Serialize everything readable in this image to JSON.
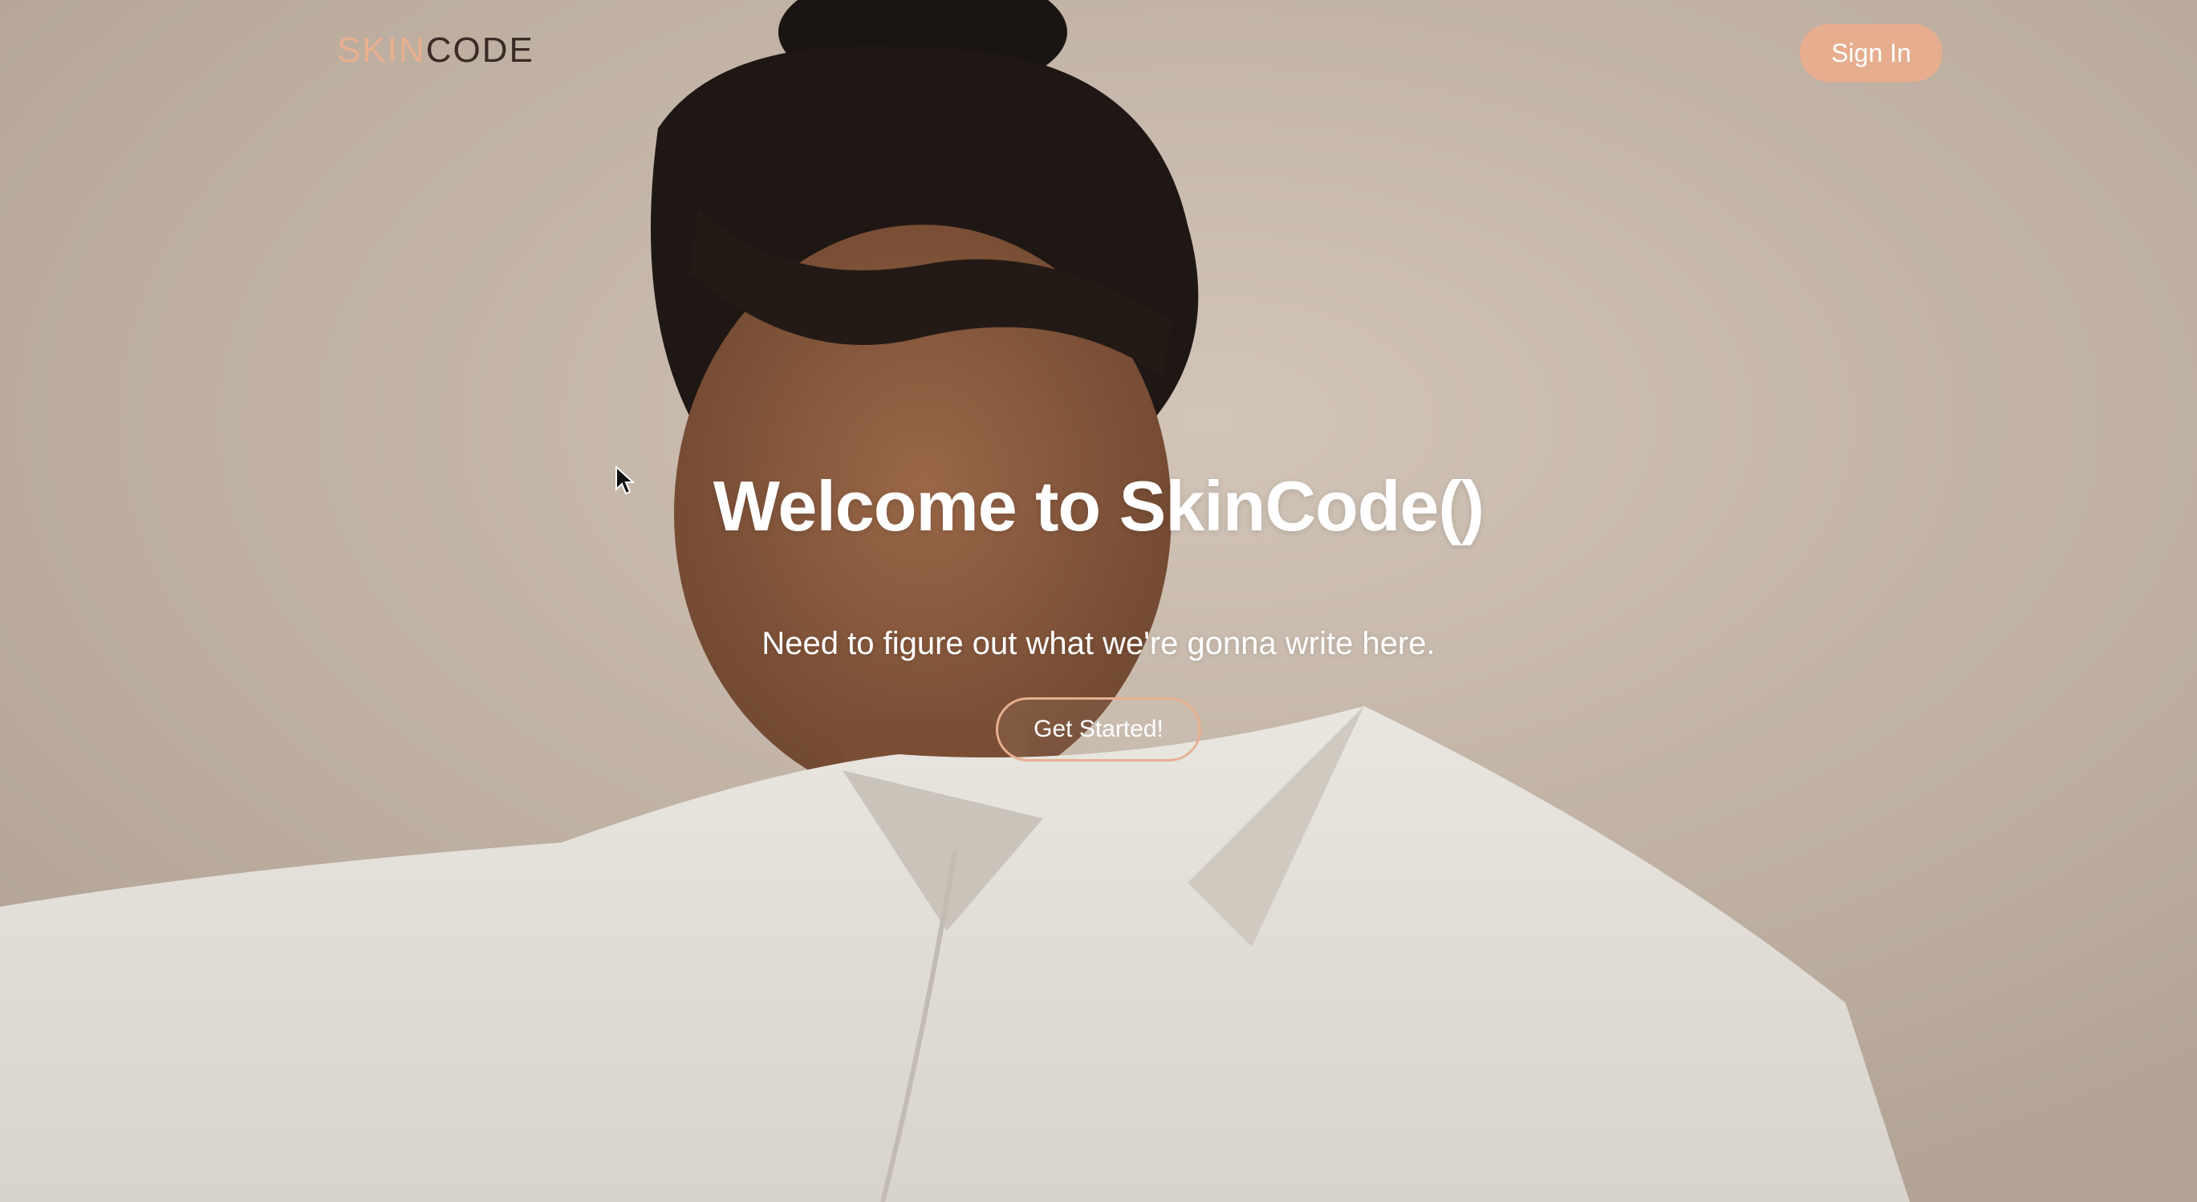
{
  "nav": {
    "logo_part1": "SKIN",
    "logo_part2": "CODE",
    "signin_label": "Sign In"
  },
  "hero": {
    "title": "Welcome to SkinCode()",
    "subtitle": "Need to figure out what we're gonna write here.",
    "cta_label": "Get Started!"
  },
  "colors": {
    "accent": "#e6ad8e",
    "logo_dark": "#3a2c24",
    "background": "#c2b3a5"
  }
}
